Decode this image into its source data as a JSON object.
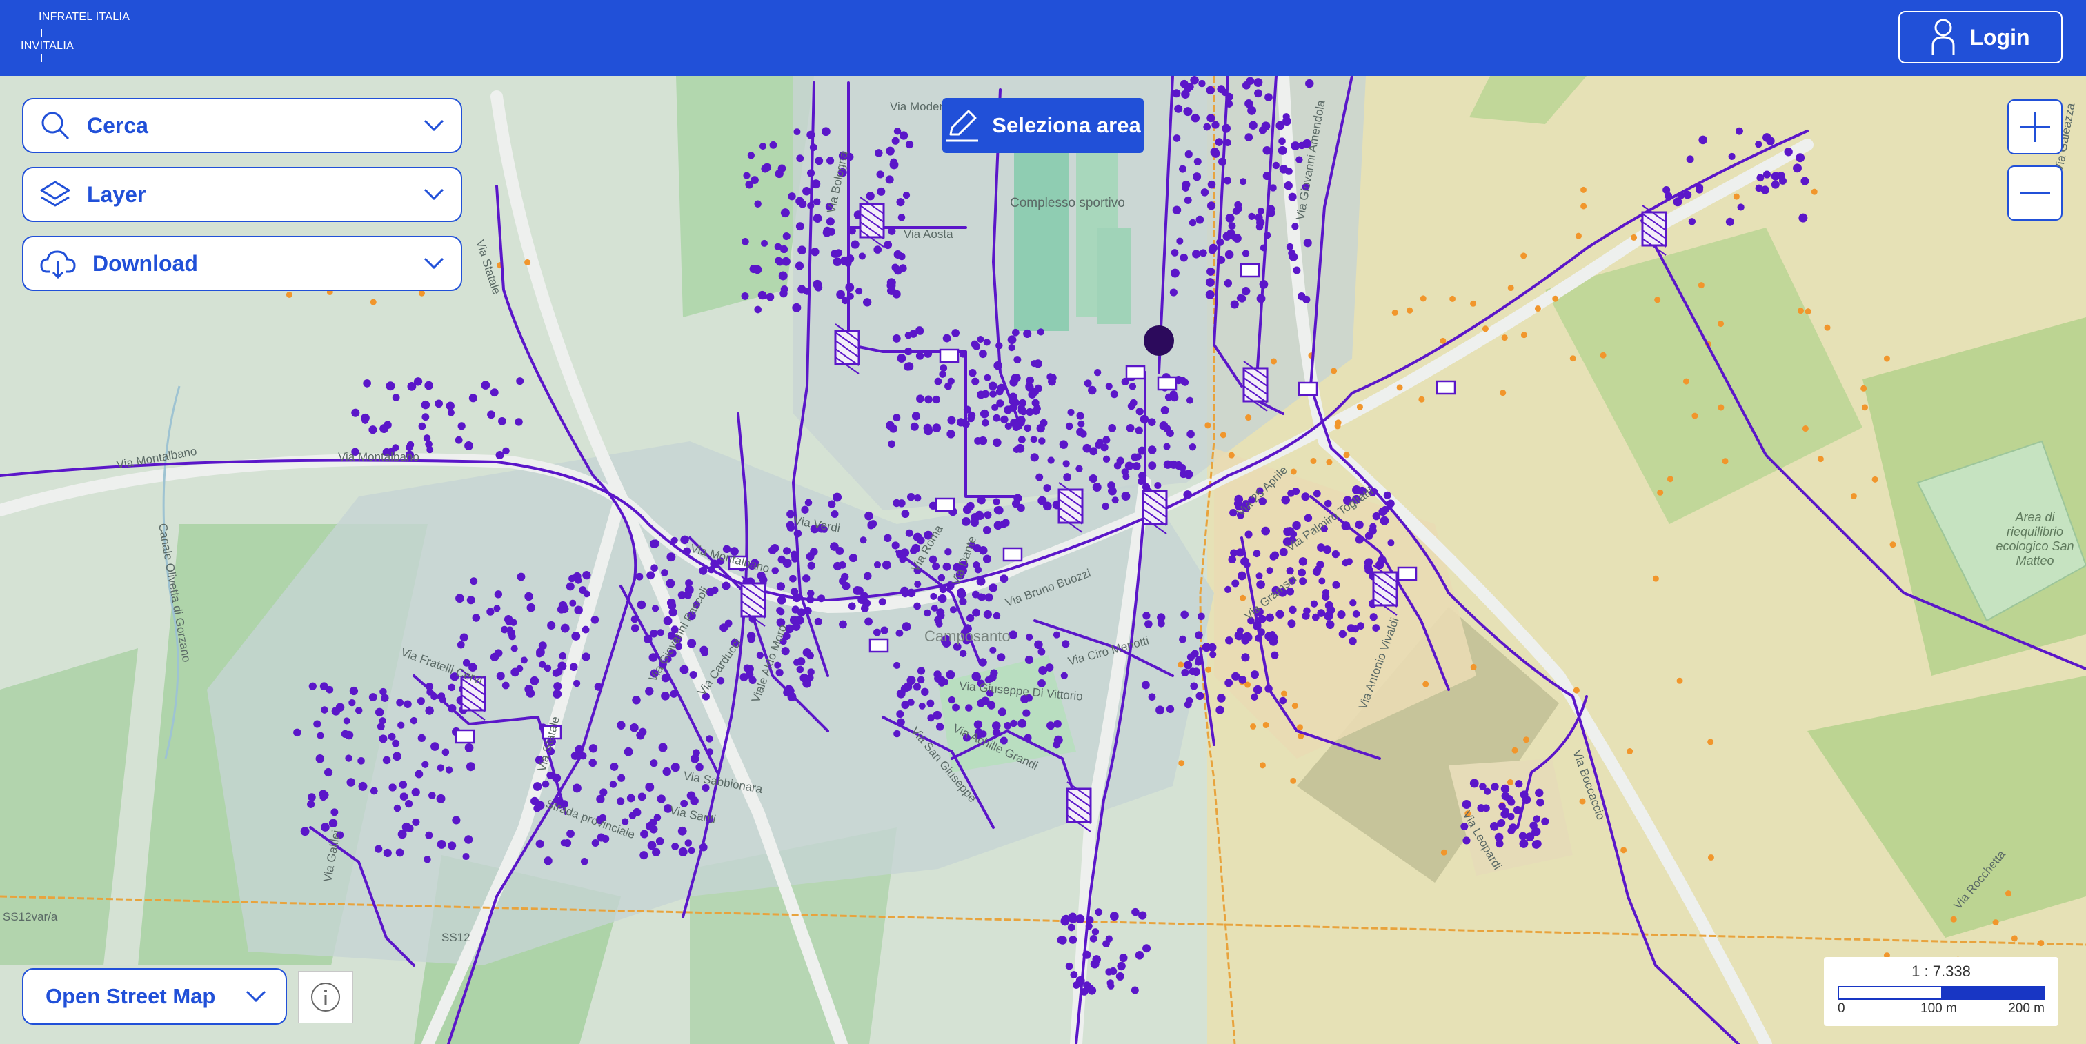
{
  "header": {
    "brand_line1": "INFRATEL ITALIA",
    "brand_line2": "INVITALIA",
    "login_label": "Login",
    "background_color": "#2150d8"
  },
  "panels": {
    "search_label": "Cerca",
    "layer_label": "Layer",
    "download_label": "Download"
  },
  "select_area_label": "Seleziona area",
  "zoom": {
    "in_icon": "plus-icon",
    "out_icon": "minus-icon"
  },
  "basemap": {
    "label": "Open Street Map",
    "info_icon": "info-icon"
  },
  "scale": {
    "ratio": "1 : 7.338",
    "tick_0": "0",
    "tick_100": "100 m",
    "tick_200": "200 m"
  },
  "map": {
    "labels": {
      "via_montalbano_1": "Via Montalbano",
      "via_montalbano_2": "Via Montalbano",
      "via_statale_1": "Via Statale",
      "via_statale_2": "Via Statale",
      "canale": "Canale Olivetta di Gorzano",
      "complesso_sportivo": "Complesso sportivo",
      "via_bologna": "Via Bologna",
      "via_modena": "Via Modena",
      "via_aosta": "Via Aosta",
      "via_verdi": "Via Verdi",
      "via_roma": "Via Roma",
      "via_dante": "Via Dante",
      "via_brunzi": "Via Bruno Buozzi",
      "via_menotti": "Via Ciro Menotti",
      "via_di_vittorio": "Via Giuseppe Di Vittorio",
      "via_grandi": "Via Achille Grandi",
      "via_san_giuseppe": "Via San Giuseppe",
      "via_pascoli": "Via Giovanni Pascoli",
      "via_carducci": "Via Carducci",
      "viale_aldo_moro": "Viale Aldo Moro",
      "via_sabbionara": "Via Sabbionara",
      "via_santi": "Via Santi",
      "via_galilei": "Via Galilei",
      "via_provinciale": "Strada provinciale",
      "ss12": "SS12",
      "ss12var": "SS12var/a",
      "via_fratelli_cervi": "Via Fratelli Cervi",
      "via_aprile": "Via 25 Aprile",
      "via_togliatti": "Via Palmiro Togliatti",
      "via_ammendola": "Via Giovanni Amendola",
      "via_gramsci": "Via Gramsci",
      "via_vivaldi": "Via Antonio Vivaldi",
      "via_boccaccio": "Via Boccaccio",
      "via_leopardi": "Via Leopardi",
      "via_rocchetta": "Via Rocchetta",
      "via_galeazza": "Via Galeazza",
      "town": "Camposanto",
      "area_riequilibrio": "Area di riequilibrio ecologico San Matteo"
    },
    "fiber_color": "#5b16c9",
    "dot_color": "#5b16c9",
    "orange_dot_color": "#f1962c",
    "boundary_color": "#e8a33d"
  }
}
